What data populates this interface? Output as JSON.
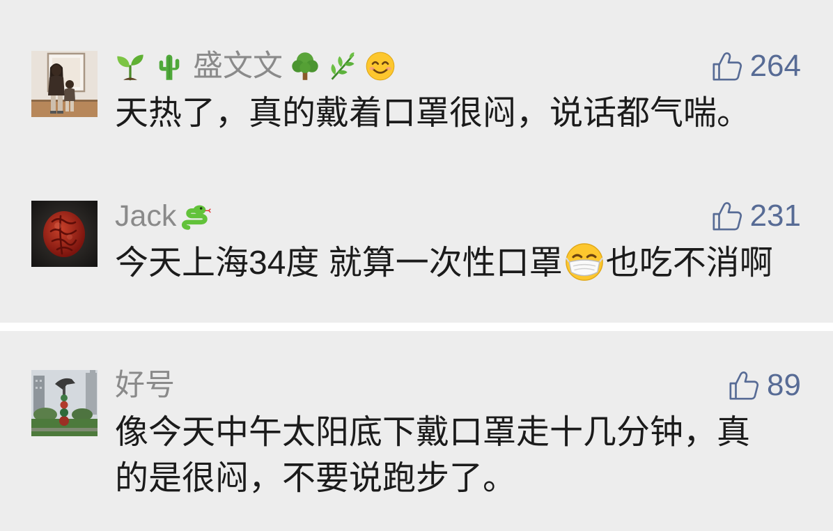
{
  "colors": {
    "background": "#ededed",
    "divider": "#ffffff",
    "name": "#8a8a8a",
    "text": "#1b1b1b",
    "like": "#576b95"
  },
  "comments": [
    {
      "avatar_icon": "avatar-photo-person",
      "name_prefix_icons": [
        "seedling-icon",
        "cactus-icon"
      ],
      "name": "盛文文",
      "name_suffix_icons": [
        "deciduous-tree-icon",
        "herb-icon",
        "smiling-face-icon"
      ],
      "like_icon": "thumbs-up-icon",
      "likes": "264",
      "text": "天热了，真的戴着口罩很闷，说话都气喘。"
    },
    {
      "avatar_icon": "avatar-red-seal",
      "name": "Jack",
      "name_suffix_icons": [
        "snake-icon"
      ],
      "like_icon": "thumbs-up-icon",
      "likes": "231",
      "text_before_icon": "今天上海34度 就算一次性口罩",
      "text_icon": "face-with-medical-mask-icon",
      "text_after_icon": "也吃不消啊"
    },
    {
      "avatar_icon": "avatar-sculpture-photo",
      "name": "好号",
      "like_icon": "thumbs-up-icon",
      "likes": "89",
      "text_lines": [
        "像今天中午太阳底下戴口罩走十几分钟，真",
        "的是很闷，不要说跑步了。"
      ]
    }
  ]
}
